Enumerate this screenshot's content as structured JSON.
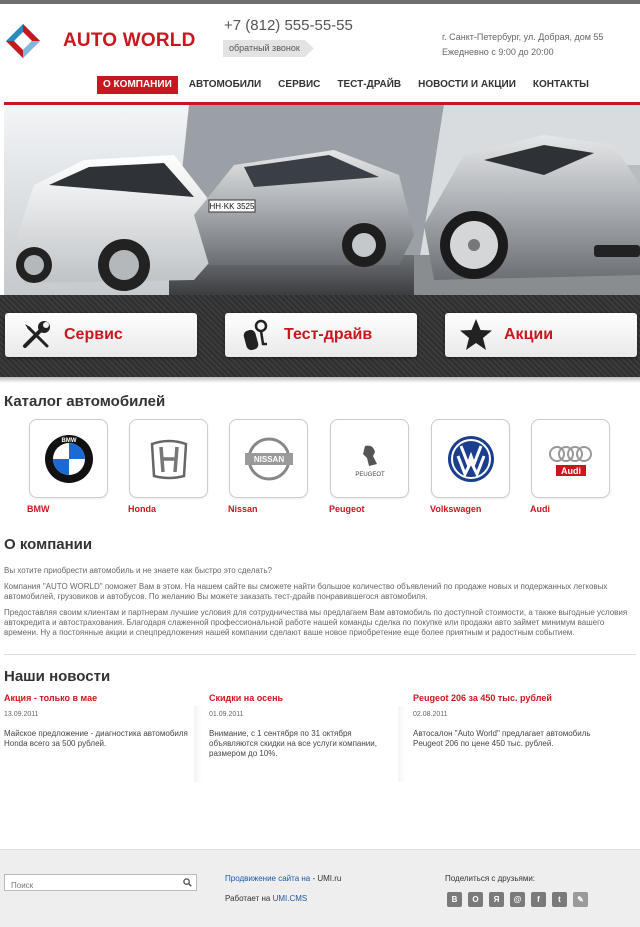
{
  "header": {
    "brand": "AUTO WORLD",
    "phone": "+7 (812) 555-55-55",
    "callback_label": "обратный звонок",
    "address": "г. Санкт-Петербург, ул. Добрая, дом 55",
    "hours": "Ежедневно с 9:00 до 20:00"
  },
  "nav": [
    {
      "label": "О КОМПАНИИ",
      "active": true
    },
    {
      "label": "АВТОМОБИЛИ"
    },
    {
      "label": "СЕРВИС"
    },
    {
      "label": "ТЕСТ-ДРАЙВ"
    },
    {
      "label": "НОВОСТИ И АКЦИИ"
    },
    {
      "label": "КОНТАКТЫ"
    }
  ],
  "hero": {
    "plate_text": "HH·KK 3525"
  },
  "features": [
    {
      "label": "Сервис",
      "icon": "wrench-screwdriver-icon"
    },
    {
      "label": "Тест-драйв",
      "icon": "car-keys-icon"
    },
    {
      "label": "Акции",
      "icon": "star-icon"
    }
  ],
  "catalog": {
    "title": "Каталог автомобилей",
    "brands": [
      {
        "name": "BMW",
        "icon": "bmw-logo-icon"
      },
      {
        "name": "Honda",
        "icon": "honda-logo-icon"
      },
      {
        "name": "Nissan",
        "icon": "nissan-logo-icon"
      },
      {
        "name": "Peugeot",
        "icon": "peugeot-logo-icon"
      },
      {
        "name": "Volkswagen",
        "icon": "volkswagen-logo-icon"
      },
      {
        "name": "Audi",
        "icon": "audi-logo-icon"
      }
    ],
    "logo_text": {
      "bmw": "BMW",
      "nissan": "NISSAN",
      "peugeot": "PEUGEOT",
      "audi": "Audi"
    }
  },
  "about": {
    "title": "О компании",
    "p1": "Вы хотите приобрести автомобиль и не знаете как быстро это сделать?",
    "p2": "Компания \"AUTO WORLD\" поможет Вам в этом. На нашем сайте вы сможете найти большое количество объявлений по продаже новых и подержанных легковых автомобилей, грузовиков и автобусов. По желанию Вы можете заказать тест-драйв понравившегося автомобиля.",
    "p3": "Предоставляя своим клиентам и партнерам лучшие условия для сотрудничества мы предлагаем Вам автомобиль по доступной стоимости, а также выгодные условия автокредита и автострахования. Благодаря слаженной профессиональной работе нашей команды сделка по покупке или продажи авто займет минимум вашего времени. Ну а постоянные акции и спецпредложения нашей компании сделают ваше новое приобретение еще более приятным и радостным событием."
  },
  "news": {
    "title": "Наши новости",
    "items": [
      {
        "title": "Акция - только в мае",
        "date": "13.09.2011",
        "text": "Майское предложение - диагностика автомобиля Honda всего за 500 рублей."
      },
      {
        "title": "Скидки на осень",
        "date": "01.09.2011",
        "text": "Внимание, с 1 сентября по 31 октября объявляются скидки на все услуги компании, размером до 10%."
      },
      {
        "title": "Peugeot 206 за 450 тыс. рублей",
        "date": "02.08.2011",
        "text": "Автосалон \"Auto World\" предлагает автомобиль Peugeot 206 по цене 450 тыс. рублей."
      }
    ]
  },
  "footer": {
    "search_placeholder": "Поиск",
    "promo_link": "Продвижение сайта на",
    "promo_suffix": " - UMI.ru",
    "works_on": "Работает на ",
    "cms_link": "UMI.CMS",
    "share_label": "Поделиться с друзьями:",
    "socials": [
      {
        "glyph": "В",
        "icon": "vkontakte-icon"
      },
      {
        "glyph": "О",
        "icon": "odnoklassniki-icon"
      },
      {
        "glyph": "Я",
        "icon": "yandex-icon"
      },
      {
        "glyph": "@",
        "icon": "mail-ru-icon"
      },
      {
        "glyph": "f",
        "icon": "facebook-icon"
      },
      {
        "glyph": "t",
        "icon": "twitter-icon"
      },
      {
        "glyph": "✎",
        "icon": "livejournal-icon"
      }
    ]
  },
  "colors": {
    "accent": "#c8171e",
    "link": "#1d5aa8",
    "footer_bg": "#eeeeee"
  }
}
